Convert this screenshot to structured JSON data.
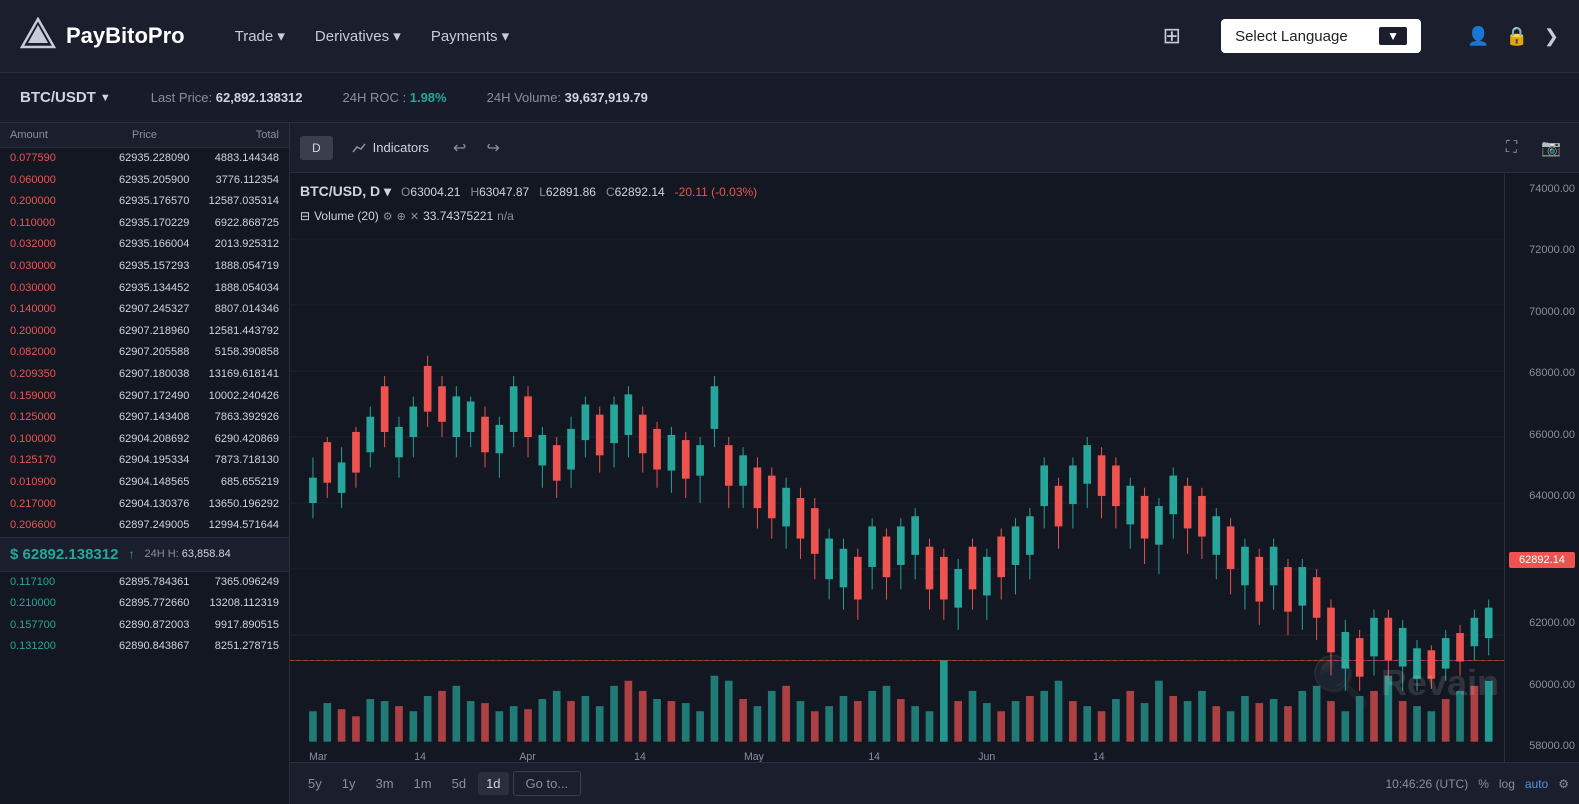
{
  "navbar": {
    "logo_text": "PayBitoPro",
    "nav_items": [
      {
        "label": "Trade ▾",
        "id": "trade"
      },
      {
        "label": "Derivatives ▾",
        "id": "derivatives"
      },
      {
        "label": "Payments ▾",
        "id": "payments"
      }
    ],
    "lang_selector": "Select Language",
    "grid_icon": "⊞"
  },
  "ticker": {
    "pair": "BTC/USDT",
    "last_price_label": "Last Price:",
    "last_price": "62,892.138312",
    "roc_label": "24H ROC :",
    "roc": "1.98%",
    "volume_label": "24H Volume:",
    "volume": "39,637,919.79"
  },
  "order_book": {
    "headers": [
      "Amount",
      "Price",
      "Total"
    ],
    "sell_rows": [
      {
        "amount": "0.077590",
        "price": "62935.228090",
        "total": "4883.144348"
      },
      {
        "amount": "0.060000",
        "price": "62935.205900",
        "total": "3776.112354"
      },
      {
        "amount": "0.200000",
        "price": "62935.176570",
        "total": "12587.035314"
      },
      {
        "amount": "0.110000",
        "price": "62935.170229",
        "total": "6922.868725"
      },
      {
        "amount": "0.032000",
        "price": "62935.166004",
        "total": "2013.925312"
      },
      {
        "amount": "0.030000",
        "price": "62935.157293",
        "total": "1888.054719"
      },
      {
        "amount": "0.030000",
        "price": "62935.134452",
        "total": "1888.054034"
      },
      {
        "amount": "0.140000",
        "price": "62907.245327",
        "total": "8807.014346"
      },
      {
        "amount": "0.200000",
        "price": "62907.218960",
        "total": "12581.443792"
      },
      {
        "amount": "0.082000",
        "price": "62907.205588",
        "total": "5158.390858"
      },
      {
        "amount": "0.209350",
        "price": "62907.180038",
        "total": "13169.618141"
      },
      {
        "amount": "0.159000",
        "price": "62907.172490",
        "total": "10002.240426"
      },
      {
        "amount": "0.125000",
        "price": "62907.143408",
        "total": "7863.392926"
      },
      {
        "amount": "0.100000",
        "price": "62904.208692",
        "total": "6290.420869"
      },
      {
        "amount": "0.125170",
        "price": "62904.195334",
        "total": "7873.718130"
      },
      {
        "amount": "0.010900",
        "price": "62904.148565",
        "total": "685.655219"
      },
      {
        "amount": "0.217000",
        "price": "62904.130376",
        "total": "13650.196292"
      },
      {
        "amount": "0.206600",
        "price": "62897.249005",
        "total": "12994.571644"
      }
    ],
    "mid_price": "$ 62892.138312",
    "mid_arrow": "↑",
    "mid_ath_label": "24H H:",
    "mid_ath": "63,858.84",
    "buy_rows": [
      {
        "amount": "0.117100",
        "price": "62895.784361",
        "total": "7365.096249"
      },
      {
        "amount": "0.210000",
        "price": "62895.772660",
        "total": "13208.112319"
      },
      {
        "amount": "0.157700",
        "price": "62890.872003",
        "total": "9917.890515"
      },
      {
        "amount": "0.131200",
        "price": "62890.843867",
        "total": "8251.278715"
      }
    ]
  },
  "chart": {
    "pair": "BTC/USD, D",
    "open_label": "O",
    "open": "63004.21",
    "high_label": "H",
    "high": "63047.87",
    "low_label": "L",
    "low": "62891.86",
    "close_label": "C",
    "close": "62892.14",
    "change": "-20.11 (-0.03%)",
    "volume_label": "Volume (20)",
    "volume_val": "33.74375221",
    "volume_na": "n/a",
    "current_price": "62892.14",
    "price_levels": [
      "74000.00",
      "72000.00",
      "70000.00",
      "68000.00",
      "66000.00",
      "64000.00",
      "62000.00",
      "60000.00",
      "58000.00"
    ],
    "time_labels": [
      "Mar",
      "14",
      "Apr",
      "14",
      "May",
      "14",
      "Jun"
    ],
    "time_buttons": [
      "5y",
      "1y",
      "3m",
      "1m",
      "5d",
      "1d"
    ],
    "goto_btn": "Go to...",
    "bottom_right": {
      "time": "10:46:26 (UTC)",
      "percent": "%",
      "log": "log",
      "auto": "auto",
      "settings": "⚙"
    }
  }
}
